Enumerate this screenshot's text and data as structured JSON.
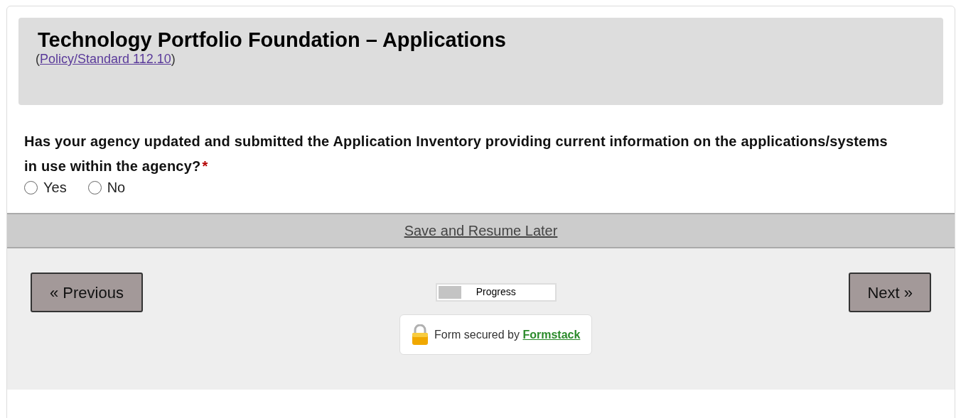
{
  "header": {
    "title": "Technology Portfolio Foundation – Applications",
    "reference_open": "(",
    "reference_link": "Policy/Standard 112.10",
    "reference_close": ")"
  },
  "question": {
    "text": "Has your agency updated and submitted the Application Inventory providing current information on the applications/systems in use within the agency?",
    "required_mark": "*",
    "options": [
      {
        "label": "Yes",
        "selected": false
      },
      {
        "label": "No",
        "selected": false
      }
    ]
  },
  "save_link": "Save and Resume Later",
  "navigation": {
    "previous": "« Previous",
    "next": "Next »"
  },
  "progress": {
    "label": "Progress",
    "level": 0.2
  },
  "security": {
    "text": "Form secured by",
    "link": "Formstack"
  }
}
